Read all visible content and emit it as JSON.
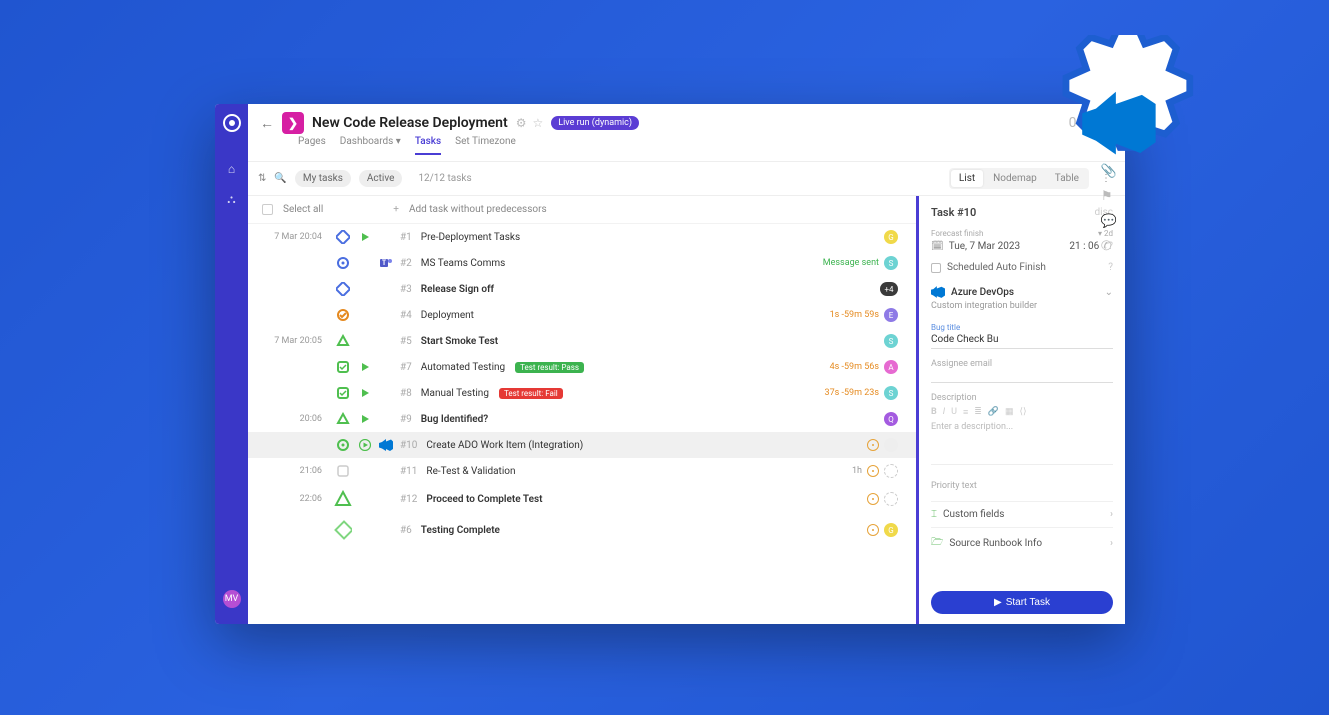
{
  "header": {
    "project_name": "New Code Release Deployment",
    "live_badge": "Live run (dynamic)",
    "timer": "0d 00:",
    "tabs": [
      "Pages",
      "Dashboards ▾",
      "Tasks",
      "Set Timezone"
    ],
    "active_tab": "Tasks"
  },
  "toolbar": {
    "my_tasks": "My tasks",
    "active": "Active",
    "count": "12/12 tasks",
    "views": [
      "List",
      "Nodemap",
      "Table"
    ],
    "active_view": "List"
  },
  "select_row": {
    "select_all": "Select all",
    "add_task": "Add task without predecessors"
  },
  "tasks": [
    {
      "time": "7 Mar 20:04",
      "num": "#1",
      "name": "Pre-Deployment Tasks",
      "bold": false,
      "node": "diamond-blue",
      "play": "play-green",
      "icon": "",
      "badge": "",
      "right_meta": "",
      "avatars": [
        {
          "t": "G",
          "c": "#f0d94a"
        }
      ]
    },
    {
      "time": "",
      "num": "#2",
      "name": "MS Teams Comms",
      "bold": false,
      "node": "gear-blue",
      "play": "",
      "icon": "teams",
      "badge": "",
      "right_meta": "Message sent",
      "right_meta_class": "green",
      "avatars": [
        {
          "t": "S",
          "c": "#6dd3d3"
        }
      ]
    },
    {
      "time": "",
      "num": "#3",
      "name": "Release Sign off",
      "bold": true,
      "node": "diamond-blue",
      "play": "",
      "icon": "",
      "badge": "",
      "right_meta": "",
      "plus4": "+4"
    },
    {
      "time": "",
      "num": "#4",
      "name": "Deployment",
      "bold": false,
      "node": "check-orange",
      "play": "",
      "icon": "",
      "badge": "",
      "right_meta": "1s  -59m 59s",
      "right_meta_class": "orange",
      "avatars": [
        {
          "t": "E",
          "c": "#8e7ae6"
        }
      ]
    },
    {
      "time": "7 Mar 20:05",
      "num": "#5",
      "name": "Start Smoke Test",
      "bold": true,
      "node": "tri-green",
      "play": "",
      "icon": "",
      "badge": "",
      "right_meta": "",
      "avatars": [
        {
          "t": "S",
          "c": "#6dd3d3"
        }
      ]
    },
    {
      "time": "",
      "num": "#7",
      "name": "Automated Testing",
      "bold": false,
      "node": "square-green",
      "play": "play-green",
      "icon": "",
      "badge": "Test result: Pass",
      "badge_class": "green",
      "right_meta": "4s  -59m 56s",
      "right_meta_class": "orange",
      "avatars": [
        {
          "t": "A",
          "c": "#e66ad1"
        }
      ]
    },
    {
      "time": "",
      "num": "#8",
      "name": "Manual Testing",
      "bold": false,
      "node": "square-green",
      "play": "play-green",
      "icon": "",
      "badge": "Test result: Fail",
      "badge_class": "red",
      "right_meta": "37s  -59m 23s",
      "right_meta_class": "orange",
      "avatars": [
        {
          "t": "S",
          "c": "#6dd3d3"
        }
      ]
    },
    {
      "time": "20:06",
      "num": "#9",
      "name": "Bug Identified?",
      "bold": true,
      "node": "tri-green",
      "play": "play-green",
      "icon": "",
      "badge": "",
      "right_meta": "",
      "avatars": [
        {
          "t": "Q",
          "c": "#a45be0"
        }
      ]
    },
    {
      "time": "",
      "num": "#10",
      "name": "Create ADO Work Item (Integration)",
      "bold": false,
      "node": "gear-green",
      "play": "play-bold",
      "icon": "ado",
      "badge": "",
      "right_meta": "",
      "selected": true,
      "c_icon": true,
      "empty_av": true
    },
    {
      "time": "21:06",
      "num": "#11",
      "name": "Re-Test & Validation",
      "bold": false,
      "node": "square-gray",
      "play": "",
      "icon": "",
      "badge": "",
      "right_meta": "1h",
      "c_icon": true,
      "ring": true
    },
    {
      "time": "22:06",
      "num": "#12",
      "name": "Proceed to Complete Test",
      "bold": true,
      "node": "tri-green-big",
      "play": "",
      "icon": "",
      "badge": "",
      "right_meta": "",
      "c_icon": true,
      "ring": true
    },
    {
      "time": "",
      "num": "#6",
      "name": "Testing Complete",
      "bold": true,
      "node": "diamond-green-big",
      "play": "",
      "icon": "",
      "badge": "",
      "right_meta": "",
      "c_icon": true,
      "avatars": [
        {
          "t": "G",
          "c": "#f0d94a"
        }
      ]
    }
  ],
  "side": {
    "task_id": "Task #10",
    "discard": "disc",
    "forecast_label": "Forecast finish",
    "forecast_delta": "▾ 2d",
    "forecast_date": "Tue, 7 Mar 2023",
    "forecast_time": "21 : 06",
    "scheduled_auto": "Scheduled Auto Finish",
    "integration_name": "Azure DevOps",
    "integration_sub": "Custom integration builder",
    "bug_title_label": "Bug title",
    "bug_title_value": "Code Check Bu",
    "assignee_label": "Assignee email",
    "description_label": "Description",
    "description_ph": "Enter a description...",
    "priority_label": "Priority text",
    "custom_fields": "Custom fields",
    "source_runbook": "Source Runbook Info",
    "start_task": "Start Task"
  },
  "rail_avatar": "MV"
}
